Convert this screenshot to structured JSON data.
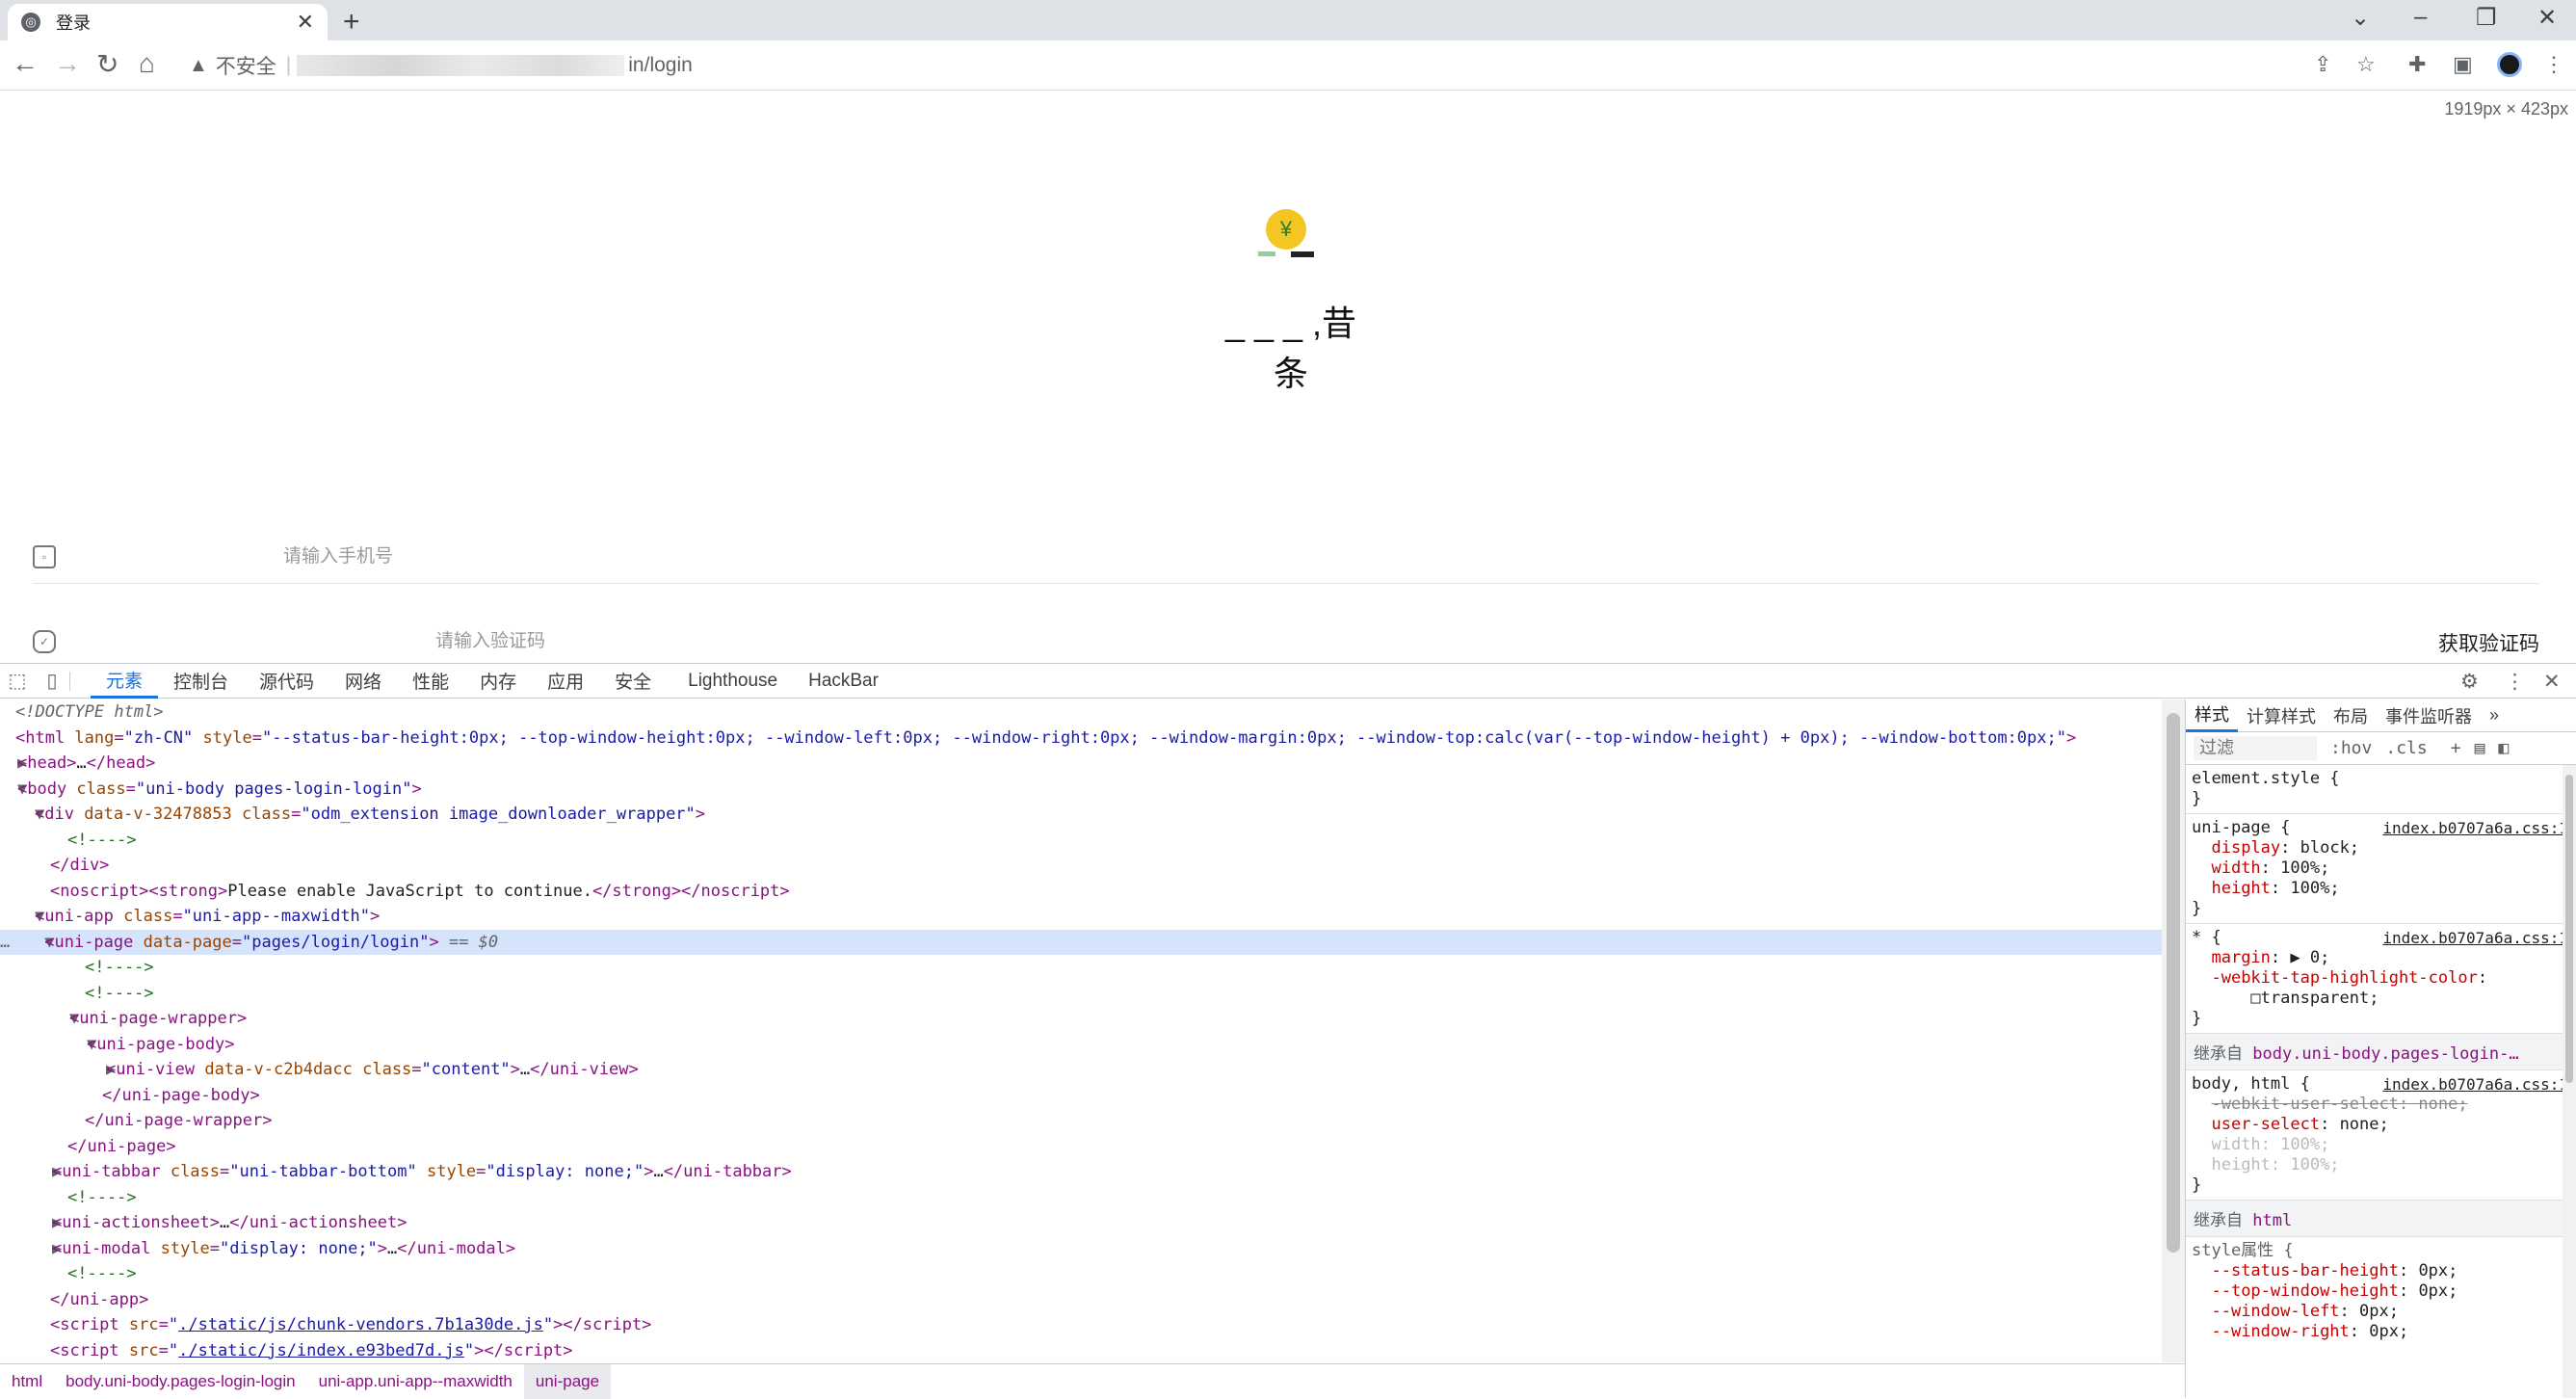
{
  "browser": {
    "tab_title": "登录",
    "tab_close": "✕",
    "new_tab": "+",
    "address_insecure": "不安全",
    "address_path": "in/login"
  },
  "page": {
    "dimensions": "1919px × 423px",
    "app_name": "_ _ _ ,昔条",
    "phone_placeholder": "请输入手机号",
    "code_placeholder": "请输入验证码",
    "get_code_label": "获取验证码"
  },
  "devtools": {
    "tabs": [
      "元素",
      "控制台",
      "源代码",
      "网络",
      "性能",
      "内存",
      "应用",
      "安全",
      "Lighthouse",
      "HackBar"
    ],
    "breadcrumbs": [
      "html",
      "body.uni-body.pages-login-login",
      "uni-app.uni-app--maxwidth",
      "uni-page"
    ],
    "elements": {
      "doctype": "<!DOCTYPE html>",
      "html_style": "--status-bar-height:0px; --top-window-height:0px; --window-left:0px; --window-right:0px; --window-margin:0px; --window-top:calc(var(--top-window-height) + 0px); --window-bottom:0px;",
      "selected_marker": "== $0",
      "noscript_text": "Please enable JavaScript to continue.",
      "script1_src": "./static/js/chunk-vendors.7b1a30de.js",
      "script2_src": "./static/js/index.e93bed7d.js"
    },
    "styles": {
      "tabs": [
        "样式",
        "计算样式",
        "布局",
        "事件监听器"
      ],
      "filter_placeholder": "过滤",
      "hov": ":hov",
      "cls": ".cls",
      "source": "index.b0707a6a.css:1",
      "inherited_body": "继承自",
      "inherited_body_selector": "body.uni-body.pages-login-…",
      "inherited_html_selector": "html",
      "style_attr_label": "style属性 {"
    }
  }
}
